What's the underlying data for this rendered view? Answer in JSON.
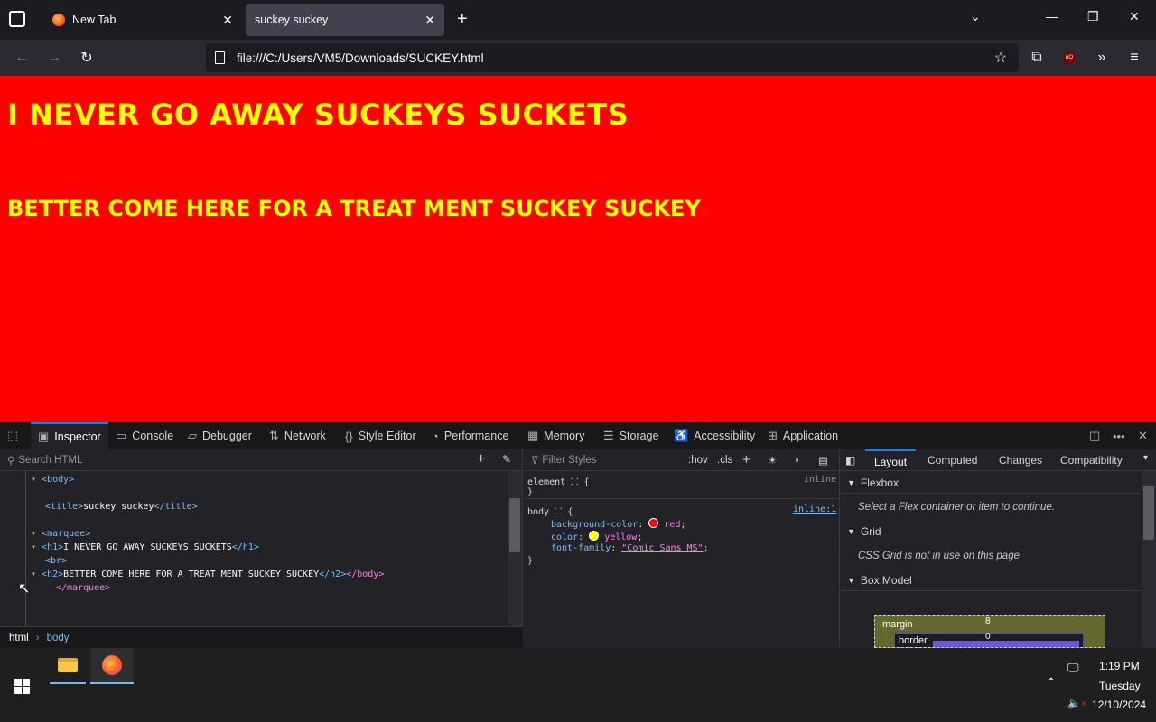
{
  "browser": {
    "tabs": [
      {
        "label": "New Tab",
        "active": false
      },
      {
        "label": "suckey suckey",
        "active": true
      }
    ],
    "url": "file:///C:/Users/VM5/Downloads/SUCKEY.html"
  },
  "page": {
    "h1": "I NEVER GO AWAY SUCKEYS SUCKETS",
    "h2": "BETTER COME HERE FOR A TREAT MENT SUCKEY SUCKEY",
    "background": "#ff0000",
    "text_color": "#ffff00"
  },
  "devtools": {
    "tabs": [
      "Inspector",
      "Console",
      "Debugger",
      "Network",
      "Style Editor",
      "Performance",
      "Memory",
      "Storage",
      "Accessibility",
      "Application"
    ],
    "search_placeholder": "Search HTML",
    "html_lines": [
      "<body>",
      "<title>",
      "suckey suckey",
      "</title>",
      "<marquee>",
      "<h1>",
      "I NEVER GO AWAY SUCKEYS SUCKETS",
      "</h1>",
      "<br>",
      "<h2>",
      "BETTER COME HERE FOR A TREAT MENT SUCKEY SUCKEY",
      "</h2>",
      "</body>",
      "</marquee>"
    ],
    "breadcrumb": [
      "html",
      "body"
    ],
    "filter_placeholder": "Filter Styles",
    "hov": ":hov",
    "cls": ".cls",
    "rules": {
      "element_selector": "element",
      "element_source": "inline",
      "body_selector": "body",
      "body_source": "inline:1",
      "props": [
        {
          "name": "background-color",
          "value": "red",
          "swatch": "#ff0000"
        },
        {
          "name": "color",
          "value": "yellow",
          "swatch": "#ffff00"
        },
        {
          "name": "font-family",
          "value": "\"Comic Sans MS\""
        }
      ]
    },
    "side_tabs": [
      "Layout",
      "Computed",
      "Changes",
      "Compatibility"
    ],
    "sections": [
      {
        "title": "Flexbox",
        "message": "Select a Flex container or item to continue."
      },
      {
        "title": "Grid",
        "message": "CSS Grid is not in use on this page"
      },
      {
        "title": "Box Model",
        "message": ""
      }
    ],
    "box_model": {
      "margin_label": "margin",
      "margin_value": "8",
      "border_label": "border",
      "border_value": "0"
    }
  },
  "taskbar": {
    "time": "1:19 PM",
    "day": "Tuesday",
    "date": "12/10/2024"
  }
}
